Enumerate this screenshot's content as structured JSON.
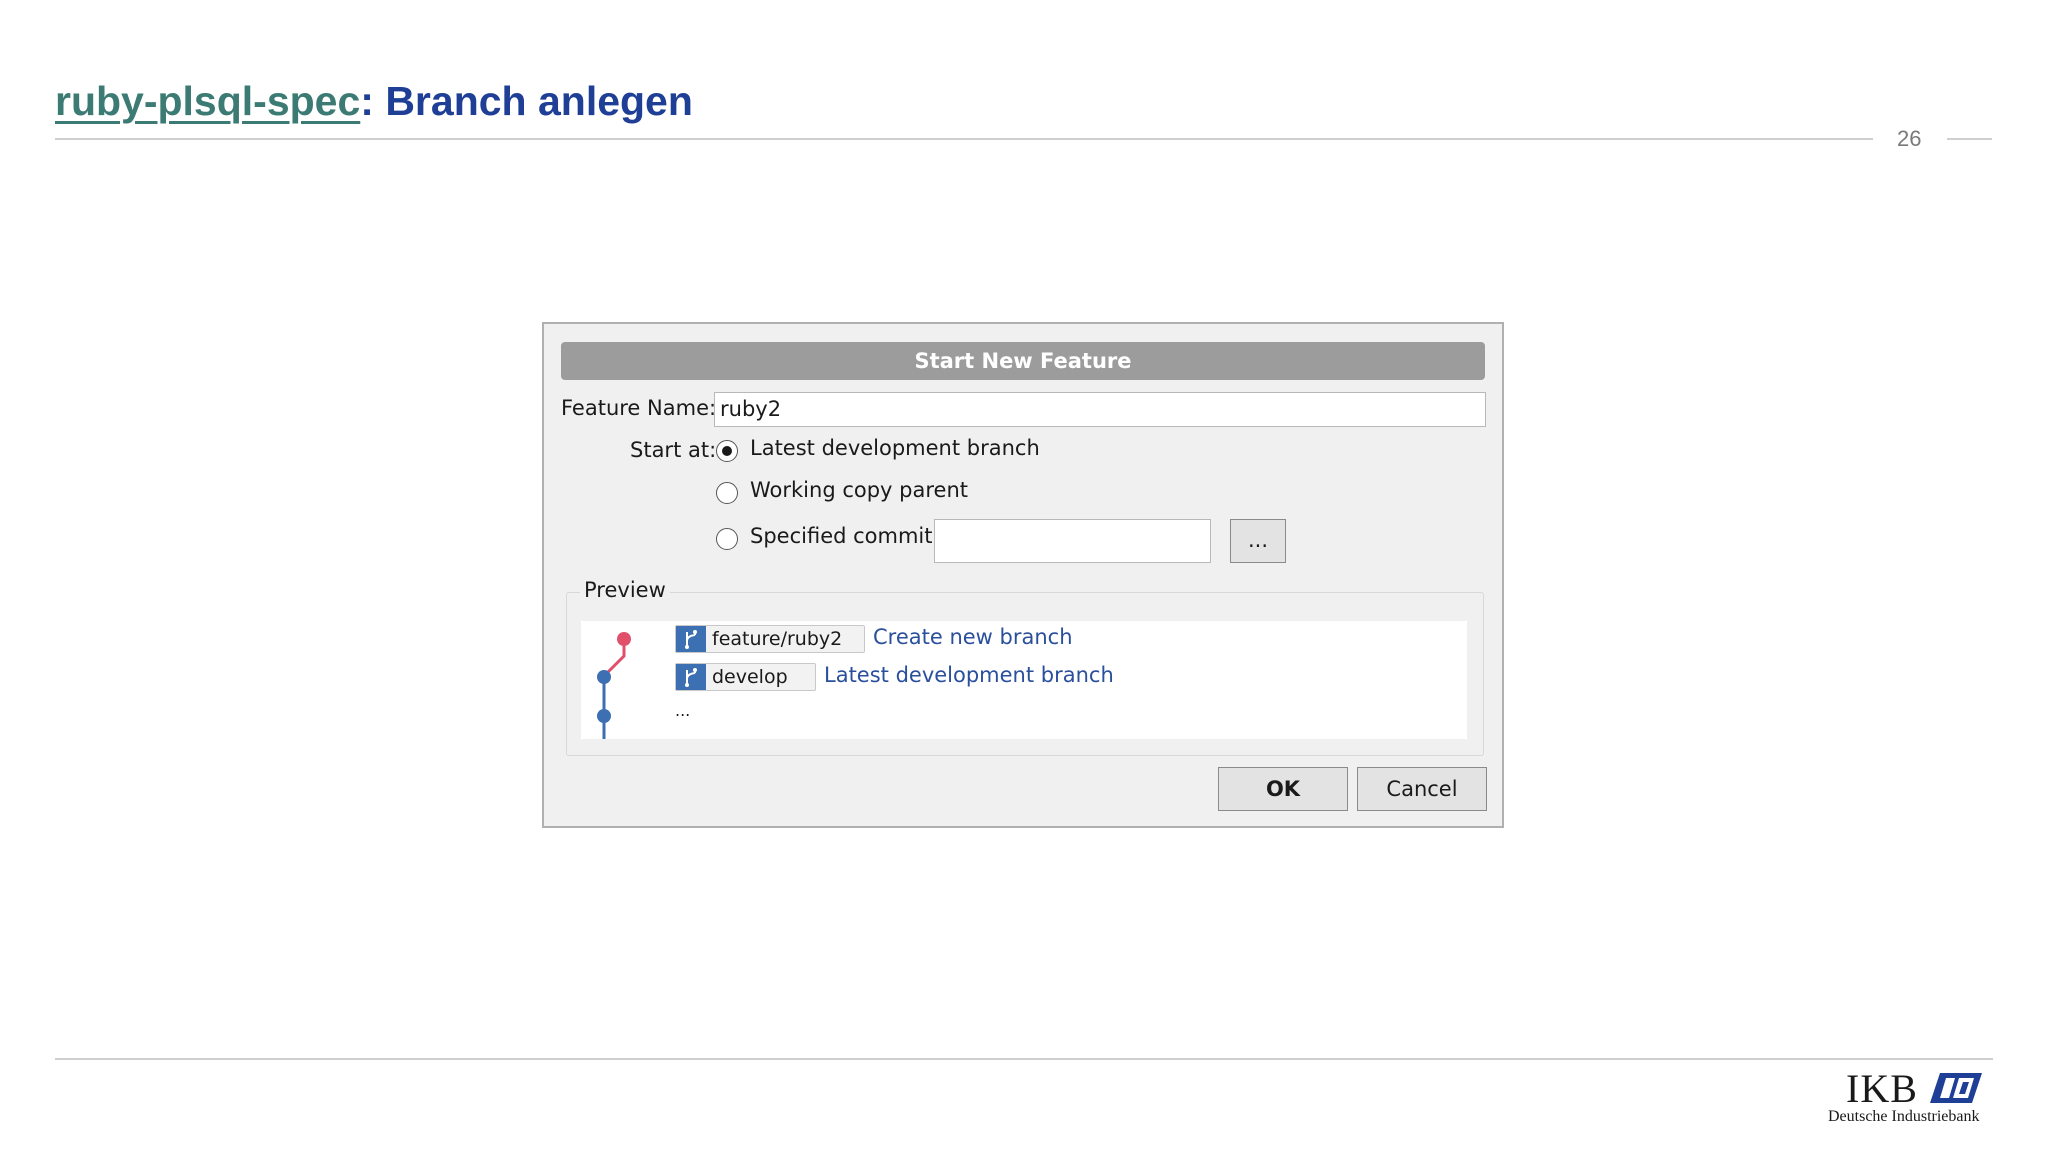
{
  "slide": {
    "title_link": "ruby-plsql-spec",
    "title_rest": ": Branch anlegen",
    "page_number": "26"
  },
  "logo": {
    "text": "IKB",
    "subtitle": "Deutsche Industriebank"
  },
  "dialog": {
    "title": "Start New Feature",
    "feature_name_label": "Feature Name:",
    "feature_name_value": "ruby2",
    "start_at_label": "Start at:",
    "options": [
      {
        "label": "Latest development branch",
        "selected": true
      },
      {
        "label": "Working copy parent",
        "selected": false
      },
      {
        "label": "Specified commit:",
        "selected": false
      }
    ],
    "commit_value": "",
    "browse_label": "...",
    "preview_label": "Preview",
    "preview_rows": [
      {
        "branch": "feature/ruby2",
        "description": "Create new branch",
        "node_color": "#e0506b"
      },
      {
        "branch": "develop",
        "description": "Latest development branch",
        "node_color": "#3d6fb3"
      }
    ],
    "preview_more": "...",
    "ok_label": "OK",
    "cancel_label": "Cancel"
  }
}
